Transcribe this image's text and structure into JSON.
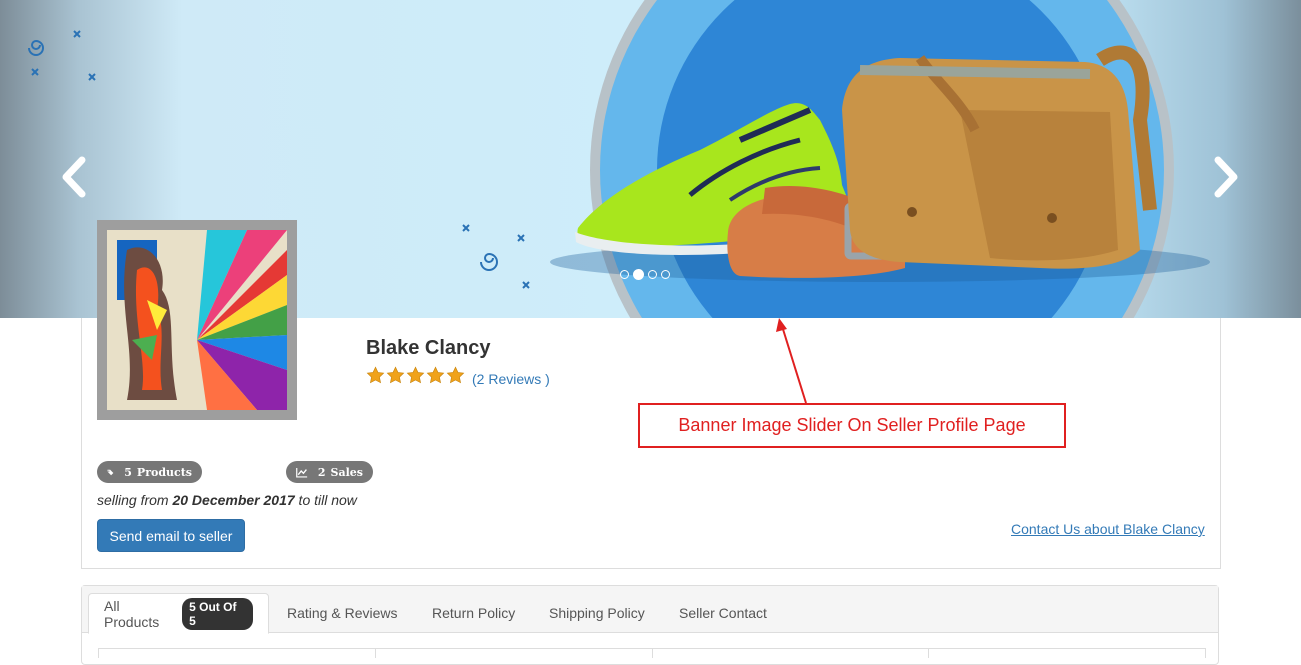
{
  "banner": {
    "prev_icon": "chevron-left-icon",
    "next_icon": "chevron-right-icon",
    "slide_count": 4,
    "active_slide": 2
  },
  "seller": {
    "name": "Blake Clancy",
    "rating": 5,
    "rating_max": 5,
    "reviews_label": "(2 Reviews )",
    "products_count": "5",
    "products_label": "Products",
    "sales_count": "2",
    "sales_label": "Sales",
    "selling_prefix": "selling from ",
    "selling_date": "20 December 2017",
    "selling_suffix": " to till now",
    "send_email_label": "Send email to seller",
    "contact_label": "Contact Us about Blake Clancy"
  },
  "annotation": {
    "label": "Banner Image Slider On Seller Profile Page",
    "color": "#e02020"
  },
  "tabs": {
    "items": [
      {
        "label": "All Products",
        "badge": "5 Out Of 5",
        "active": true
      },
      {
        "label": "Rating & Reviews"
      },
      {
        "label": "Return Policy"
      },
      {
        "label": "Shipping Policy"
      },
      {
        "label": "Seller Contact"
      }
    ]
  },
  "colors": {
    "primary": "#337ab7",
    "badge_gray": "#777777",
    "star": "#f0a21a",
    "annotation_red": "#e02020"
  }
}
